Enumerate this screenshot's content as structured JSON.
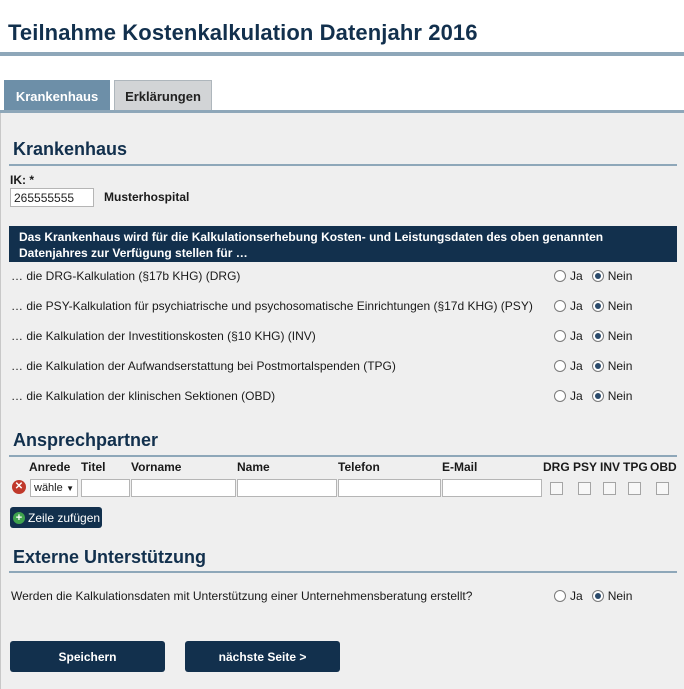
{
  "page": {
    "title": "Teilnahme Kostenkalkulation Datenjahr 2016"
  },
  "tabs": [
    {
      "label": "Krankenhaus"
    },
    {
      "label": "Erklärungen"
    }
  ],
  "hospital": {
    "section_title": "Krankenhaus",
    "ik_label": "IK: *",
    "ik_value": "265555555",
    "name": "Musterhospital",
    "info_text": "Das Krankenhaus wird für die Kalkulationserhebung Kosten- und Leistungsdaten des oben genannten Datenjahres zur Verfügung stellen für …",
    "questions": [
      {
        "text": "… die DRG-Kalkulation (§17b KHG) (DRG)",
        "yes": "Ja",
        "no": "Nein",
        "selected": "Nein"
      },
      {
        "text": "… die PSY-Kalkulation für psychiatrische und psychosomatische Einrichtungen (§17d KHG) (PSY)",
        "yes": "Ja",
        "no": "Nein",
        "selected": "Nein"
      },
      {
        "text": "… die Kalkulation der Investitionskosten (§10 KHG) (INV)",
        "yes": "Ja",
        "no": "Nein",
        "selected": "Nein"
      },
      {
        "text": "… die Kalkulation der Aufwandserstattung bei Postmortalspenden (TPG)",
        "yes": "Ja",
        "no": "Nein",
        "selected": "Nein"
      },
      {
        "text": "… die Kalkulation der klinischen Sektionen (OBD)",
        "yes": "Ja",
        "no": "Nein",
        "selected": "Nein"
      }
    ]
  },
  "contacts": {
    "section_title": "Ansprechpartner",
    "columns": {
      "anrede": "Anrede",
      "titel": "Titel",
      "vorname": "Vorname",
      "name": "Name",
      "telefon": "Telefon",
      "email": "E-Mail",
      "drg": "DRG",
      "psy": "PSY",
      "inv": "INV",
      "tpg": "TPG",
      "obd": "OBD"
    },
    "row": {
      "anrede_value": "wähle",
      "delete_icon": "trash-icon"
    },
    "add_row_label": "Zeile zufügen"
  },
  "external": {
    "section_title": "Externe Unterstützung",
    "question": "Werden die Kalkulationsdaten mit Unterstützung einer Unternehmensberatung erstellt?",
    "yes": "Ja",
    "no": "Nein",
    "selected": "Nein"
  },
  "buttons": {
    "save": "Speichern",
    "next": "nächste Seite >"
  },
  "colors": {
    "navy": "#12304d",
    "accent": "#8ea7b9",
    "tab_active": "#6d8fa8",
    "background": "#efefef"
  }
}
